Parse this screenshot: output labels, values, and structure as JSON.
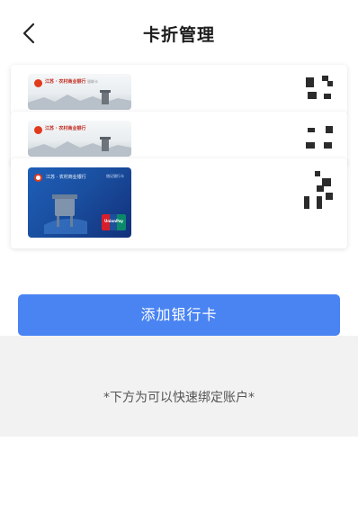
{
  "header": {
    "title": "卡折管理",
    "back_icon": "chevron-left-icon"
  },
  "cards": [
    {
      "style": "grey",
      "bank_name": "江苏 · 农村商业银行",
      "sub_label": "银联卡"
    },
    {
      "style": "grey",
      "bank_name": "江苏 · 农村商业银行",
      "sub_label": ""
    },
    {
      "style": "blue",
      "bank_name": "江苏 · 农村商业银行",
      "card_label": "借记银行卡",
      "network": "UnionPay"
    }
  ],
  "actions": {
    "add_card_label": "添加银行卡"
  },
  "quick_bind": {
    "note": "*下方为可以快速绑定账户*"
  },
  "colors": {
    "primary_button": "#4a84f3",
    "gray_section": "#f2f2f2"
  }
}
